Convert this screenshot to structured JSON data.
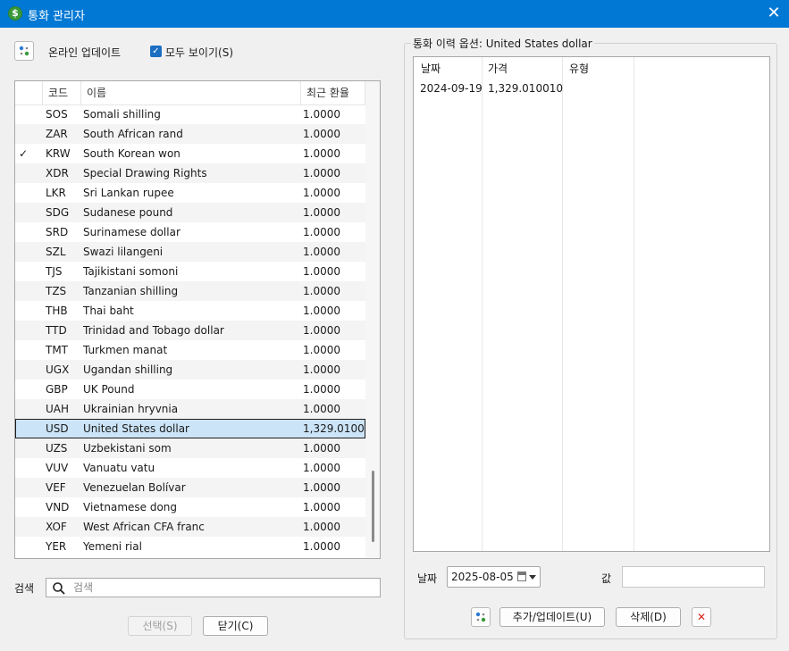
{
  "window": {
    "title": "통화 관리자"
  },
  "toolbar": {
    "online_update": "온라인 업데이트",
    "show_all": "모두 보이기(S)",
    "show_all_checked": true
  },
  "list": {
    "headers": {
      "code": "코드",
      "name": "이름",
      "rate": "최근 환율"
    },
    "rows": [
      {
        "check": "",
        "code": "SOS",
        "name": "Somali shilling",
        "rate": "1.0000"
      },
      {
        "check": "",
        "code": "ZAR",
        "name": "South African rand",
        "rate": "1.0000"
      },
      {
        "check": "✓",
        "code": "KRW",
        "name": "South Korean won",
        "rate": "1.0000"
      },
      {
        "check": "",
        "code": "XDR",
        "name": "Special Drawing Rights",
        "rate": "1.0000"
      },
      {
        "check": "",
        "code": "LKR",
        "name": "Sri Lankan rupee",
        "rate": "1.0000"
      },
      {
        "check": "",
        "code": "SDG",
        "name": "Sudanese pound",
        "rate": "1.0000"
      },
      {
        "check": "",
        "code": "SRD",
        "name": "Surinamese dollar",
        "rate": "1.0000"
      },
      {
        "check": "",
        "code": "SZL",
        "name": "Swazi lilangeni",
        "rate": "1.0000"
      },
      {
        "check": "",
        "code": "TJS",
        "name": "Tajikistani somoni",
        "rate": "1.0000"
      },
      {
        "check": "",
        "code": "TZS",
        "name": "Tanzanian shilling",
        "rate": "1.0000"
      },
      {
        "check": "",
        "code": "THB",
        "name": "Thai baht",
        "rate": "1.0000"
      },
      {
        "check": "",
        "code": "TTD",
        "name": "Trinidad and Tobago dollar",
        "rate": "1.0000"
      },
      {
        "check": "",
        "code": "TMT",
        "name": "Turkmen manat",
        "rate": "1.0000"
      },
      {
        "check": "",
        "code": "UGX",
        "name": "Ugandan shilling",
        "rate": "1.0000"
      },
      {
        "check": "",
        "code": "GBP",
        "name": "UK Pound",
        "rate": "1.0000"
      },
      {
        "check": "",
        "code": "UAH",
        "name": "Ukrainian hryvnia",
        "rate": "1.0000"
      },
      {
        "check": "",
        "code": "USD",
        "name": "United States dollar",
        "rate": "1,329.0100",
        "selected": true
      },
      {
        "check": "",
        "code": "UZS",
        "name": "Uzbekistani som",
        "rate": "1.0000"
      },
      {
        "check": "",
        "code": "VUV",
        "name": "Vanuatu vatu",
        "rate": "1.0000"
      },
      {
        "check": "",
        "code": "VEF",
        "name": "Venezuelan Bolívar",
        "rate": "1.0000"
      },
      {
        "check": "",
        "code": "VND",
        "name": "Vietnamese dong",
        "rate": "1.0000"
      },
      {
        "check": "",
        "code": "XOF",
        "name": "West African CFA franc",
        "rate": "1.0000"
      },
      {
        "check": "",
        "code": "YER",
        "name": "Yemeni rial",
        "rate": "1.0000"
      }
    ]
  },
  "search": {
    "label": "검색",
    "placeholder": "검색"
  },
  "buttons": {
    "select": "선택(S)",
    "close": "닫기(C)",
    "add_update": "추가/업데이트(U)",
    "delete": "삭제(D)"
  },
  "history": {
    "title": "통화 이력 옵션: United States dollar",
    "headers": {
      "date": "날짜",
      "price": "가격",
      "type": "유형"
    },
    "rows": [
      {
        "date": "2024-09-19",
        "price": "1,329.010010",
        "type": ""
      }
    ]
  },
  "form": {
    "date_label": "날짜",
    "date_value": "2025-08-05",
    "value_label": "값",
    "value": ""
  },
  "colors": {
    "titlebar": "#0078d4",
    "selection": "#cce4f7",
    "delete_icon": "#d9231b"
  }
}
